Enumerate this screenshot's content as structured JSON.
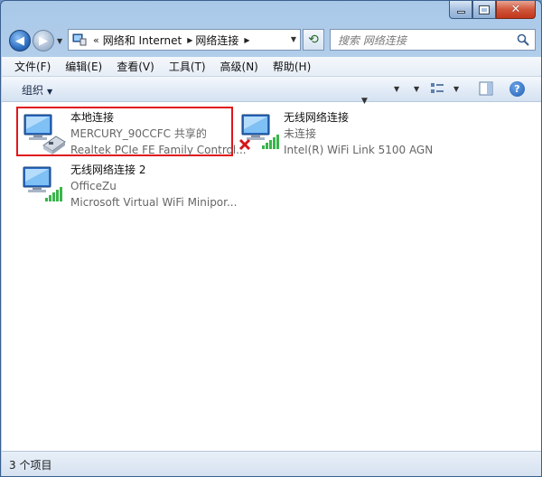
{
  "addressbar": {
    "prefix": "«",
    "crumbs": [
      "网络和 Internet",
      "网络连接"
    ]
  },
  "search": {
    "placeholder": "搜索 网络连接"
  },
  "menubar": {
    "items": [
      "文件(F)",
      "编辑(E)",
      "查看(V)",
      "工具(T)",
      "高级(N)",
      "帮助(H)"
    ]
  },
  "toolbar": {
    "organize_label": "组织"
  },
  "connections": [
    {
      "name": "本地连接",
      "status": "MERCURY_90CCFC 共享的",
      "device": "Realtek PCIe FE Family Control...",
      "icon": "wired-network-icon",
      "selected": true
    },
    {
      "name": "无线网络连接",
      "status": "未连接",
      "device": "Intel(R) WiFi Link 5100 AGN",
      "icon": "wireless-network-disconnected-icon",
      "selected": false
    },
    {
      "name": "无线网络连接 2",
      "status": "OfficeZu",
      "device": "Microsoft Virtual WiFi Minipor...",
      "icon": "wireless-network-icon",
      "selected": false
    }
  ],
  "statusbar": {
    "item_count": "3 个项目"
  },
  "colors": {
    "selection_border": "#e0161b",
    "window_frame": "#a9c8e8"
  }
}
